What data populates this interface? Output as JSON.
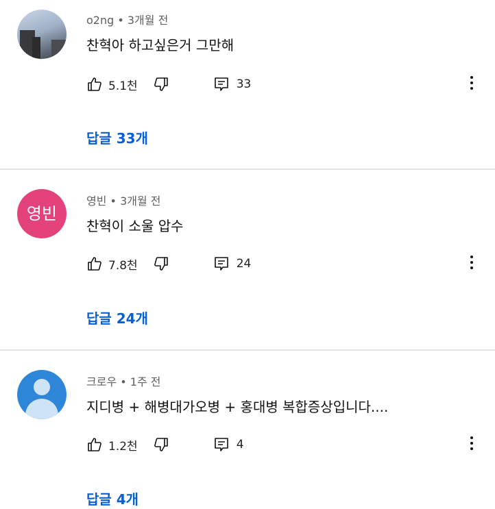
{
  "comments": [
    {
      "author": "o2ng",
      "time": "3개월 전",
      "text": "찬혁아 하고싶은거 그만해",
      "likes": "5.1천",
      "reply_count": "33",
      "replies_link": "답글 33개",
      "avatar": "photo"
    },
    {
      "author": "영빈",
      "time": "3개월 전",
      "text": "찬혁이 소울 압수",
      "likes": "7.8천",
      "reply_count": "24",
      "replies_link": "답글 24개",
      "avatar_text": "영빈",
      "avatar": "initials"
    },
    {
      "author": "크로우",
      "time": "1주 전",
      "text": "지디병 + 해병대가오병 + 홍대병  복합증상입니다....",
      "likes": "1.2천",
      "reply_count": "4",
      "replies_link": "답글 4개",
      "avatar": "default"
    }
  ],
  "meta_separator": " • ",
  "icons": [
    "thumb-up-icon",
    "thumb-down-icon",
    "reply-icon",
    "more-vert-icon"
  ],
  "colors": {
    "link": "#065fd4",
    "avatar_pink": "#e4427a",
    "avatar_blue": "#2d86d8"
  }
}
